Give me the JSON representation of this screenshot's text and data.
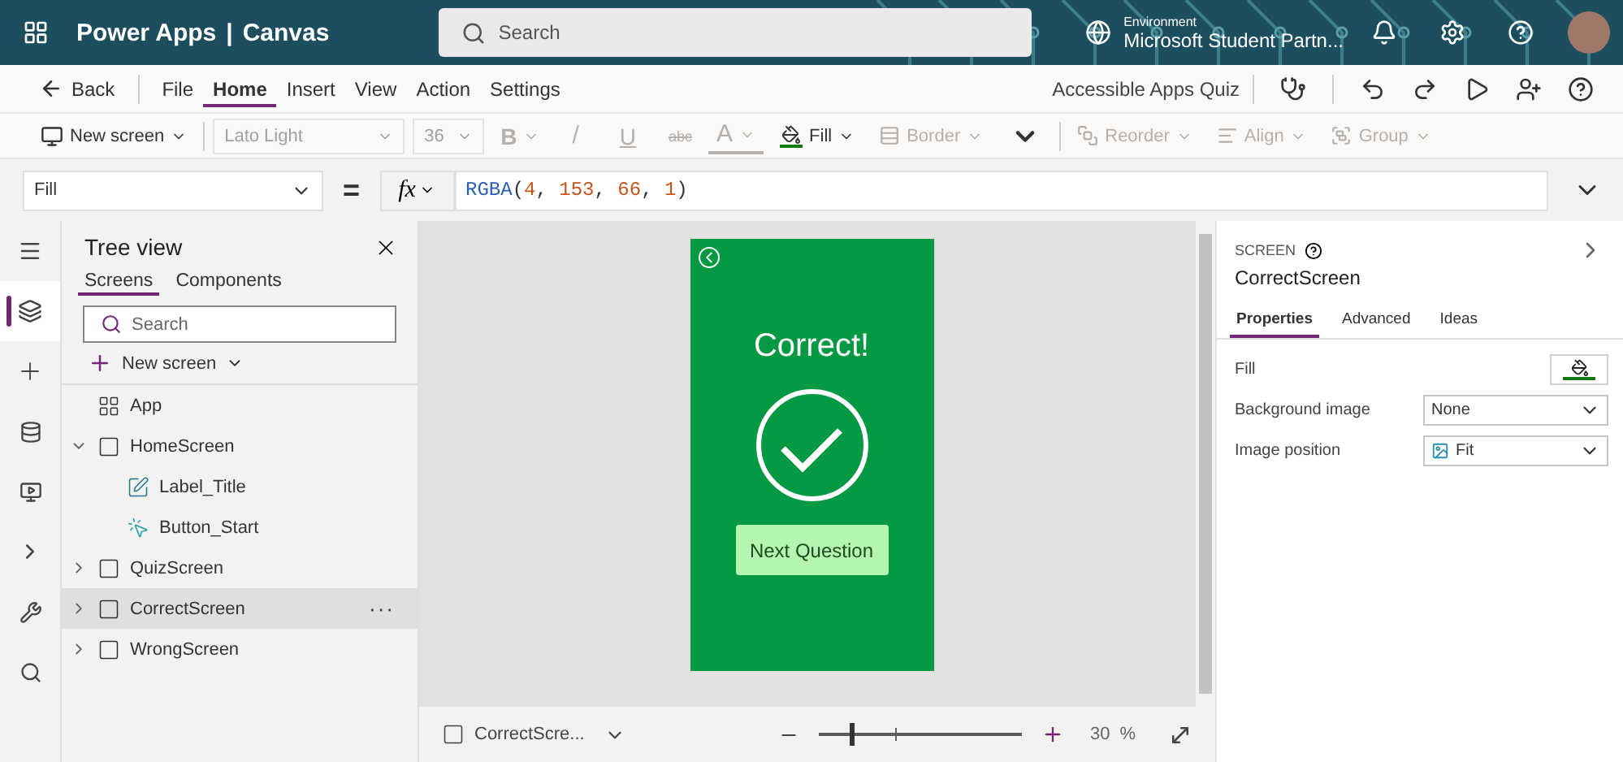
{
  "header": {
    "product": "Power Apps",
    "separator": "|",
    "mode": "Canvas",
    "search": {
      "placeholder": "Search"
    },
    "environment_label": "Environment",
    "environment_name": "Microsoft Student Partn..."
  },
  "menu": {
    "back": "Back",
    "tabs": [
      {
        "label": "File",
        "selected": false
      },
      {
        "label": "Home",
        "selected": true
      },
      {
        "label": "Insert",
        "selected": false
      },
      {
        "label": "View",
        "selected": false
      },
      {
        "label": "Action",
        "selected": false
      },
      {
        "label": "Settings",
        "selected": false
      }
    ],
    "app_name": "Accessible Apps Quiz"
  },
  "ribbon": {
    "new_screen": "New screen",
    "font": "Lato Light",
    "font_size": "36",
    "bold": "B",
    "italic": "/",
    "underline": "U",
    "strike": "abc",
    "font_color": "A",
    "fill": {
      "label": "Fill",
      "disabled": false
    },
    "items": [
      {
        "label": "Border",
        "kind": "border",
        "disabled": true
      },
      {
        "label": "Reorder",
        "kind": "reorder",
        "disabled": true
      },
      {
        "label": "Align",
        "kind": "align",
        "disabled": true
      },
      {
        "label": "Group",
        "kind": "group",
        "disabled": true
      }
    ]
  },
  "formula_bar": {
    "property": "Fill",
    "equals": "=",
    "fx": "fx",
    "tokens": [
      {
        "text": "RGBA",
        "kind": "function"
      },
      {
        "text": "(",
        "kind": "punct"
      },
      {
        "text": "4",
        "kind": "number"
      },
      {
        "text": ", ",
        "kind": "punct"
      },
      {
        "text": "153",
        "kind": "number"
      },
      {
        "text": ", ",
        "kind": "punct"
      },
      {
        "text": "66",
        "kind": "number"
      },
      {
        "text": ", ",
        "kind": "punct"
      },
      {
        "text": "1",
        "kind": "number"
      },
      {
        "text": ")",
        "kind": "punct"
      }
    ]
  },
  "tree_view": {
    "title": "Tree view",
    "tabs": [
      {
        "label": "Screens",
        "selected": true
      },
      {
        "label": "Components",
        "selected": false
      }
    ],
    "search": {
      "placeholder": "Search"
    },
    "new_screen": "New screen",
    "items": [
      {
        "label": "App",
        "kind": "app",
        "selected": false
      },
      {
        "label": "HomeScreen",
        "kind": "screen",
        "expanded": true,
        "selected": false,
        "children": [
          {
            "label": "Label_Title",
            "kind": "label",
            "selected": false
          },
          {
            "label": "Button_Start",
            "kind": "button",
            "selected": false
          }
        ]
      },
      {
        "label": "QuizScreen",
        "kind": "screen",
        "expanded": false,
        "selected": false
      },
      {
        "label": "CorrectScreen",
        "kind": "screen",
        "expanded": false,
        "selected": true,
        "more": "···"
      },
      {
        "label": "WrongScreen",
        "kind": "screen",
        "expanded": false,
        "selected": false
      }
    ]
  },
  "canvas": {
    "screen": {
      "title": "Correct!",
      "button": "Next Question"
    },
    "screen_picker": "CorrectScre...",
    "zoom": {
      "level": 0.15,
      "value": "30",
      "unit": "%"
    }
  },
  "properties_panel": {
    "type": "SCREEN",
    "name": "CorrectScreen",
    "tabs": [
      {
        "label": "Properties",
        "selected": true
      },
      {
        "label": "Advanced",
        "selected": false
      },
      {
        "label": "Ideas",
        "selected": false
      }
    ],
    "rows": [
      {
        "label": "Fill",
        "kind": "color"
      },
      {
        "label": "Background image",
        "kind": "dropdown",
        "value": "None"
      },
      {
        "label": "Image position",
        "kind": "dropdown",
        "value": "Fit",
        "icon": true
      }
    ]
  }
}
